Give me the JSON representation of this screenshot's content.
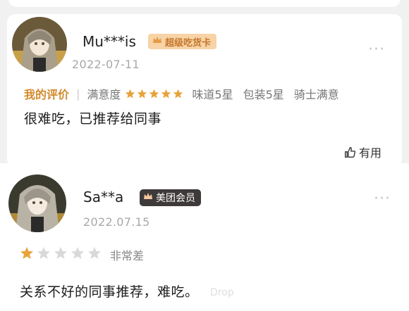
{
  "review1": {
    "username": "Mu***is",
    "badge": "超级吃货卡",
    "date": "2022-07-11",
    "my_review_label": "我的评价",
    "satisfaction_label": "满意度",
    "stars": 5,
    "taste": "味道5星",
    "packaging": "包装5星",
    "rider": "骑士满意",
    "text": "很难吃，已推荐给同事",
    "helpful_label": "有用"
  },
  "review2": {
    "username": "Sa**a",
    "badge": "美团会员",
    "date": "2022.07.15",
    "stars": 1,
    "level_text": "非常差",
    "text": "关系不好的同事推荐，难吃。"
  },
  "watermark": "Drop",
  "colors": {
    "star_gold": "#e8a33a",
    "star_gray": "#d9d9d9",
    "vip_badge_bg": "#f7d3a6",
    "member_badge_bg": "#3f3a3a",
    "accent": "#d28a2c"
  }
}
